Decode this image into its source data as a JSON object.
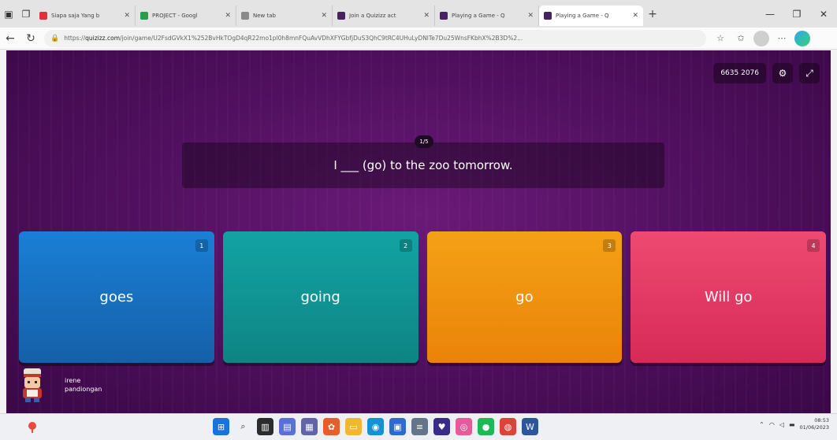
{
  "browser": {
    "tabs": [
      {
        "title": "Siapa saja Yang b",
        "favicon_color": "#e0303a",
        "active": false
      },
      {
        "title": "PROJECT - Googl",
        "favicon_color": "#2a9d4a",
        "active": false
      },
      {
        "title": "New tab",
        "favicon_color": "#8a8a8a",
        "active": false
      },
      {
        "title": "Join a Quizizz act",
        "favicon_color": "#4a2160",
        "active": false
      },
      {
        "title": "Playing a Game - Q",
        "favicon_color": "#4a2160",
        "active": false
      },
      {
        "title": "Playing a Game - Q",
        "favicon_color": "#4a2160",
        "active": true
      }
    ],
    "url_prefix": "https://",
    "url_host": "quizizz.com",
    "url_path": "/join/game/U2FsdGVkX1%252BvHkTOgD4qR22mo1pl0h8mnFQuAvVDhXFYGbfjDuS3QhC9tRC4UHuLyDNlTe7Du25WnsFKbhX%2B3D%2..."
  },
  "game": {
    "player_code": "6635 2076",
    "question_counter": "1/5",
    "question_text": "I ___ (go) to the zoo tomorrow.",
    "answers": [
      {
        "number": "1",
        "text": "goes",
        "color": "#1a7fd6"
      },
      {
        "number": "2",
        "text": "going",
        "color": "#13a3a3"
      },
      {
        "number": "3",
        "text": "go",
        "color": "#f4a116"
      },
      {
        "number": "4",
        "text": "Will go",
        "color": "#ee4a71"
      }
    ],
    "player_name_line1": "irene",
    "player_name_line2": "pandiongan"
  },
  "taskbar": {
    "time": "08:53",
    "date": "01/06/2023"
  },
  "icons": [
    "back-icon",
    "refresh-icon",
    "lock-icon",
    "star-icon",
    "collections-icon",
    "profile-icon",
    "more-icon",
    "edge-icon",
    "settings-icon",
    "fullscreen-icon",
    "windows-start-icon",
    "search-icon",
    "wifi-icon",
    "volume-icon",
    "battery-icon"
  ]
}
